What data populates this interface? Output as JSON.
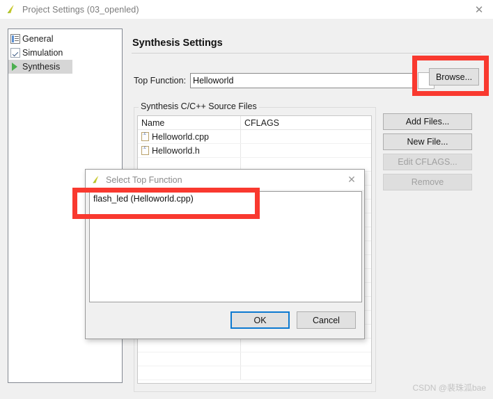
{
  "window": {
    "title": "Project Settings (03_openled)",
    "icon": "hls-leaf-icon",
    "close_label": "✕"
  },
  "sidebar": {
    "items": [
      {
        "label": "General",
        "icon": "form-list-icon",
        "selected": false
      },
      {
        "label": "Simulation",
        "icon": "checkbox-icon",
        "selected": false
      },
      {
        "label": "Synthesis",
        "icon": "play-triangle-icon",
        "selected": true
      }
    ]
  },
  "main": {
    "heading": "Synthesis Settings",
    "top_function": {
      "label": "Top Function:",
      "value": "Helloworld",
      "placeholder": "",
      "browse_label": "Browse..."
    },
    "source_files": {
      "legend": "Synthesis C/C++ Source Files",
      "columns": [
        "Name",
        "CFLAGS"
      ],
      "rows": [
        {
          "name": "Helloworld.cpp",
          "cflags": "",
          "icon": "c-file-icon"
        },
        {
          "name": "Helloworld.h",
          "cflags": "",
          "icon": "c-file-icon"
        }
      ],
      "empty_rows": 16
    },
    "side_buttons": [
      {
        "label": "Add Files...",
        "enabled": true
      },
      {
        "label": "New File...",
        "enabled": true
      },
      {
        "label": "Edit CFLAGS...",
        "enabled": false
      },
      {
        "label": "Remove",
        "enabled": false
      }
    ]
  },
  "modal": {
    "title": "Select Top Function",
    "icon": "hls-leaf-icon",
    "close_label": "✕",
    "list_items": [
      {
        "label": "flash_led (Helloworld.cpp)",
        "selected": false
      }
    ],
    "ok_label": "OK",
    "cancel_label": "Cancel"
  },
  "annotations": {
    "accent_color": "#f9392f",
    "boxes": [
      {
        "name": "browse-highlight",
        "target": "Browse..."
      },
      {
        "name": "flash-led-highlight",
        "target": "flash_led (Helloworld.cpp)"
      }
    ]
  },
  "watermark": {
    "text": "CSDN @裴珠泒bae"
  }
}
